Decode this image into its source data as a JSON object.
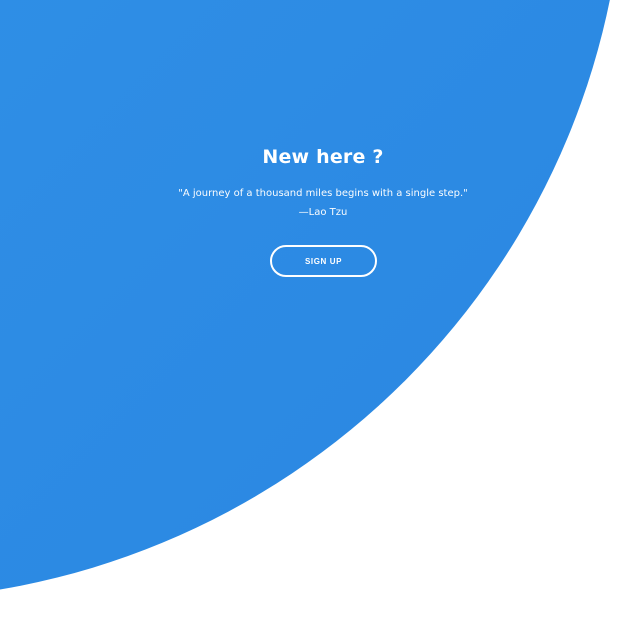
{
  "panel": {
    "heading": "New here ?",
    "quote": "\"A journey of a thousand miles begins with a single step.\"",
    "author": "—Lao Tzu",
    "button_label": "SIGN UP",
    "accent_color": "#2f8fe6"
  }
}
